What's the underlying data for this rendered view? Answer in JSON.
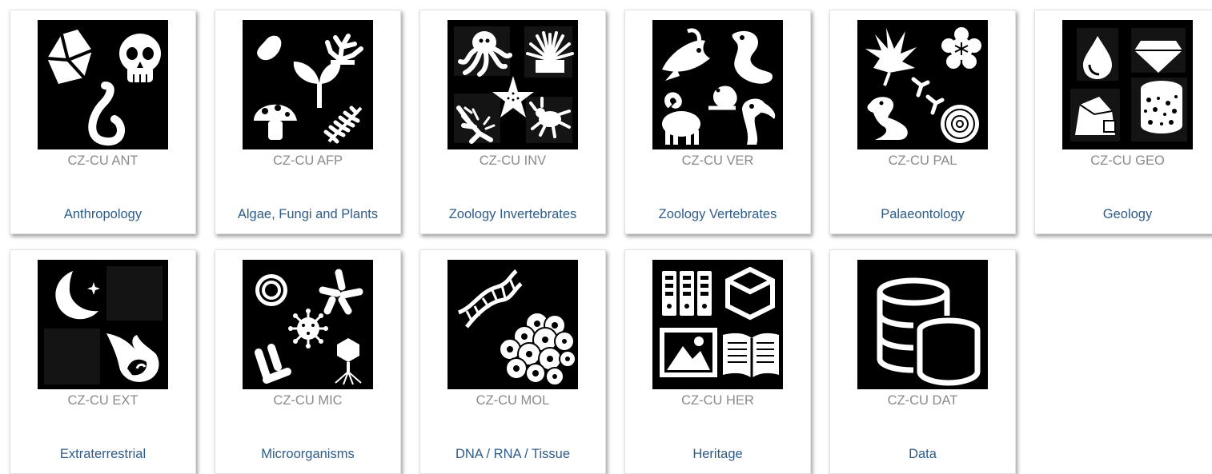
{
  "collections": [
    {
      "code": "CZ-CU ANT",
      "name": "Anthropology"
    },
    {
      "code": "CZ-CU AFP",
      "name": "Algae, Fungi and Plants"
    },
    {
      "code": "CZ-CU INV",
      "name": "Zoology Invertebrates"
    },
    {
      "code": "CZ-CU VER",
      "name": "Zoology Vertebrates"
    },
    {
      "code": "CZ-CU PAL",
      "name": "Palaeontology"
    },
    {
      "code": "CZ-CU GEO",
      "name": "Geology"
    },
    {
      "code": "CZ-CU EXT",
      "name": "Extraterrestrial"
    },
    {
      "code": "CZ-CU MIC",
      "name": "Microorganisms"
    },
    {
      "code": "CZ-CU MOL",
      "name": "DNA / RNA / Tissue"
    },
    {
      "code": "CZ-CU HER",
      "name": "Heritage"
    },
    {
      "code": "CZ-CU DAT",
      "name": "Data"
    }
  ],
  "colors": {
    "link": "#2e5c8a",
    "code": "#8a8a8a",
    "tile": "#000000"
  }
}
